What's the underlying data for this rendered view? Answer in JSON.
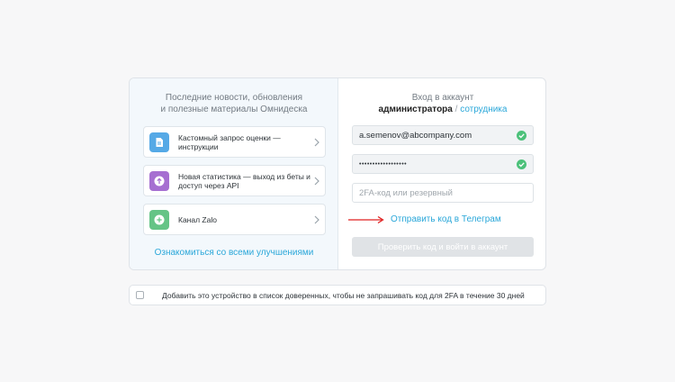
{
  "news": {
    "heading_line1": "Последние новости, обновления",
    "heading_line2": "и полезные материалы Омнидеска",
    "items": [
      {
        "label": "Кастомный запрос оценки — инструкции",
        "icon": "document-icon",
        "color": "#55a9e6"
      },
      {
        "label": "Новая статистика — выход из беты и доступ через API",
        "icon": "arrow-up-circle-icon",
        "color": "#a66fd1"
      },
      {
        "label": "Канал Zalo",
        "icon": "plus-circle-icon",
        "color": "#65c486"
      }
    ],
    "see_all": "Ознакомиться со всеми улучшениями"
  },
  "login": {
    "title": "Вход в аккаунт",
    "role_admin": "администратора",
    "role_separator": " / ",
    "role_employee": "сотрудника",
    "email_value": "a.semenov@abcompany.com",
    "password_value": "••••••••••••••••••",
    "code_placeholder": "2FA-код или резервный",
    "telegram_link": "Отправить код в Телеграм",
    "submit_label": "Проверить код и войти в аккаунт"
  },
  "trust": {
    "label": "Добавить это устройство в список доверенных, чтобы не запрашивать код для 2FA в течение 30 дней"
  },
  "colors": {
    "accent": "#2aa7d9",
    "check": "#4cc17a",
    "arrow": "#e02020"
  }
}
